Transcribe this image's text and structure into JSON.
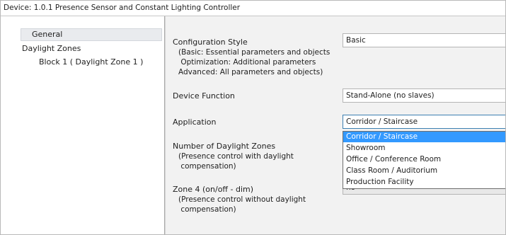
{
  "window": {
    "title": "Device: 1.0.1  Presence Sensor and Constant Lighting Controller"
  },
  "sidebar": {
    "items": [
      {
        "label": "General",
        "selected": true
      },
      {
        "label": "Daylight Zones",
        "selected": false
      },
      {
        "label": "Block 1 ( Daylight Zone 1 )",
        "selected": false
      }
    ]
  },
  "params": {
    "configuration_style": {
      "label": "Configuration Style",
      "hint": "(Basic: Essential parameters and objects\n Optimization: Additional parameters\nAdvanced: All parameters and objects)",
      "value": "Basic"
    },
    "device_function": {
      "label": "Device Function",
      "value": "Stand-Alone (no slaves)"
    },
    "application": {
      "label": "Application",
      "value": "Corridor / Staircase",
      "options": [
        {
          "label": "Corridor / Staircase",
          "selected": true
        },
        {
          "label": "Showroom",
          "selected": false
        },
        {
          "label": "Office / Conference Room",
          "selected": false
        },
        {
          "label": "Class Room / Auditorium",
          "selected": false
        },
        {
          "label": "Production Facility",
          "selected": false
        }
      ]
    },
    "daylight_zones": {
      "label": "Number of Daylight Zones",
      "hint": "(Presence control with daylight\n compensation)"
    },
    "zone4": {
      "label": "Zone 4 (on/off - dim)",
      "hint": "(Presence control without daylight\n compensation)",
      "value": "no"
    }
  },
  "colors": {
    "selection": "#3399ff",
    "focus_border": "#3c7fb1",
    "panel_background": "#f2f2f2"
  }
}
